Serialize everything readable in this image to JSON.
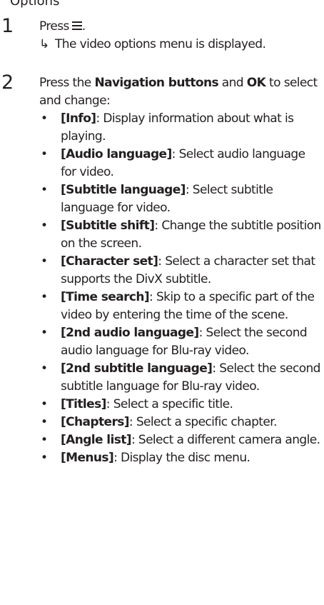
{
  "top_fragment": "Options",
  "steps": [
    {
      "number": "1",
      "text": "Press",
      "icon": "menu-icon",
      "text_after": ".",
      "result_icon": "arrow-right-icon",
      "result": "The video options menu is displayed."
    },
    {
      "number": "2",
      "intro_1": "Press the ",
      "intro_b1": "Navigation buttons",
      "intro_2": " and ",
      "intro_b2": "OK",
      "intro_3": " to select and change:",
      "options": [
        {
          "label": "[Info]",
          "desc": ": Display information about what is playing."
        },
        {
          "label": "[Audio language]",
          "desc": ": Select audio language for video."
        },
        {
          "label": "[Subtitle language]",
          "desc": ": Select subtitle language for video."
        },
        {
          "label": "[Subtitle shift]",
          "desc": ": Change the subtitle position on the screen."
        },
        {
          "label": "[Character set]",
          "desc": ": Select a character set that supports the DivX subtitle."
        },
        {
          "label": "[Time search]",
          "desc": ": Skip to a specific part of the video by entering the time of the scene."
        },
        {
          "label": "[2nd audio language]",
          "desc": ": Select the second audio language for Blu-ray video."
        },
        {
          "label": "[2nd subtitle language]",
          "desc": ": Select the second subtitle language for Blu-ray video."
        },
        {
          "label": "[Titles]",
          "desc": ": Select a specific title."
        },
        {
          "label": "[Chapters]",
          "desc": ": Select a specific chapter."
        },
        {
          "label": "[Angle list]",
          "desc": ": Select a different camera angle."
        },
        {
          "label": "[Menus]",
          "desc": ": Display the disc menu."
        }
      ]
    }
  ]
}
